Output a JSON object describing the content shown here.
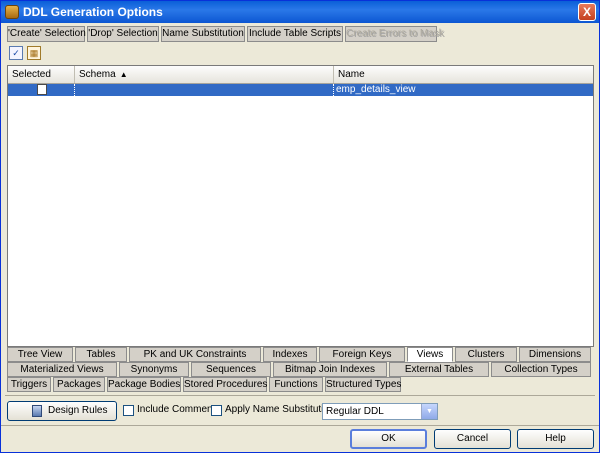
{
  "window": {
    "title": "DDL Generation Options",
    "close_label": "X"
  },
  "top_tabs": [
    {
      "label": "'Create' Selection",
      "enabled": true
    },
    {
      "label": "'Drop' Selection",
      "enabled": true
    },
    {
      "label": "Name Substitution",
      "enabled": true
    },
    {
      "label": "Include Table Scripts",
      "enabled": true
    },
    {
      "label": "Create Errors to Mask",
      "enabled": false
    }
  ],
  "toolbar": {
    "check_all_icon": "checkbox-checked-icon",
    "grid_icon": "table-grid-icon"
  },
  "table": {
    "columns": [
      "Selected",
      "Schema",
      "Name"
    ],
    "sort_column": "Schema",
    "sort_glyph": "▲",
    "rows": [
      {
        "selected": false,
        "schema": "",
        "name": "emp_details_view"
      }
    ]
  },
  "bottom_tabs": {
    "row1": [
      "Tree View",
      "Tables",
      "PK and UK Constraints",
      "Indexes",
      "Foreign Keys",
      "Views",
      "Clusters",
      "Dimensions"
    ],
    "row2": [
      "Materialized Views",
      "Synonyms",
      "Sequences",
      "Bitmap Join Indexes",
      "External Tables",
      "Collection Types"
    ],
    "row3": [
      "Triggers",
      "Packages",
      "Package Bodies",
      "Stored Procedures",
      "Functions",
      "Structured Types"
    ],
    "active": "Views"
  },
  "options": {
    "design_rules_label": "Design Rules",
    "include_comments_label": "Include Comments",
    "include_comments_checked": false,
    "apply_name_sub_label": "Apply Name Substitution",
    "apply_name_sub_checked": false,
    "ddl_mode_value": "Regular DDL"
  },
  "buttons": {
    "ok": "OK",
    "cancel": "Cancel",
    "help": "Help"
  },
  "colors": {
    "selection": "#316ac5",
    "titlebar": "#0a5fd8"
  }
}
